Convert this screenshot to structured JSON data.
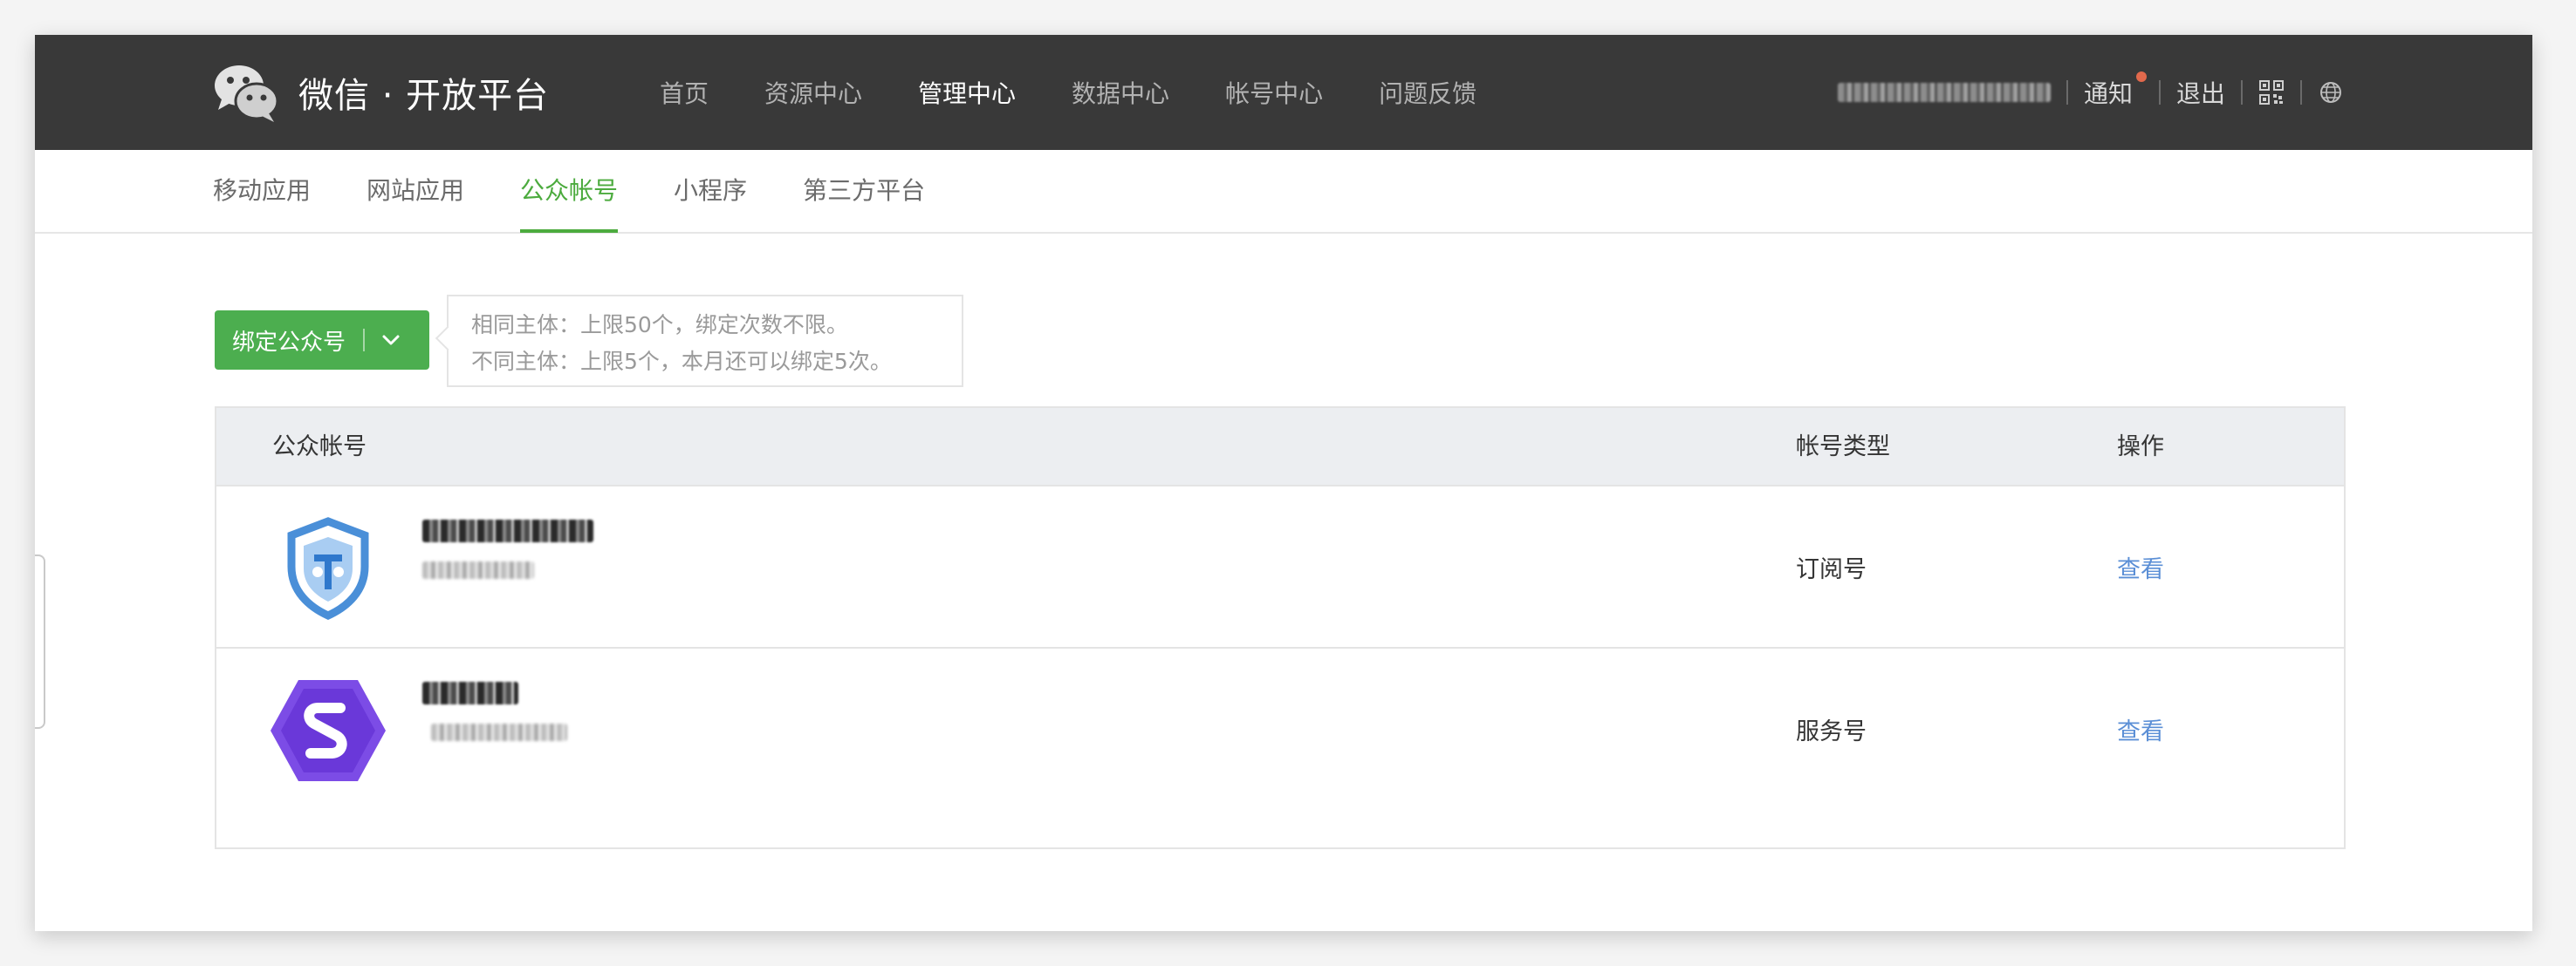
{
  "header": {
    "logo_icon": "wechat-logo-icon",
    "title": "微信 · 开放平台",
    "nav": [
      {
        "label": "首页",
        "active": false
      },
      {
        "label": "资源中心",
        "active": false
      },
      {
        "label": "管理中心",
        "active": true
      },
      {
        "label": "数据中心",
        "active": false
      },
      {
        "label": "帐号中心",
        "active": false
      },
      {
        "label": "问题反馈",
        "active": false
      }
    ],
    "notify_label": "通知",
    "logout_label": "退出",
    "qr_icon": "qrcode-icon",
    "lang_icon": "globe-icon"
  },
  "subnav": [
    {
      "label": "移动应用",
      "active": false
    },
    {
      "label": "网站应用",
      "active": false
    },
    {
      "label": "公众帐号",
      "active": true
    },
    {
      "label": "小程序",
      "active": false
    },
    {
      "label": "第三方平台",
      "active": false
    }
  ],
  "bind_button": {
    "label": "绑定公众号",
    "dropdown_icon": "chevron-down-icon"
  },
  "tip": {
    "line1": "相同主体：上限50个，绑定次数不限。",
    "line2": "不同主体：上限5个，本月还可以绑定5次。"
  },
  "table": {
    "headers": {
      "account": "公众帐号",
      "type": "帐号类型",
      "operation": "操作"
    },
    "rows": [
      {
        "avatar_icon": "shield-avatar-icon",
        "type": "订阅号",
        "action": "查看"
      },
      {
        "avatar_icon": "s-hexagon-avatar-icon",
        "type": "服务号",
        "action": "查看"
      }
    ]
  },
  "colors": {
    "topbar_bg": "#393939",
    "accent_green": "#4cab3e",
    "button_green": "#4cae4f",
    "link_blue": "#5b8fd6",
    "table_header_bg": "#eceef1",
    "notify_dot": "#e2694c"
  }
}
